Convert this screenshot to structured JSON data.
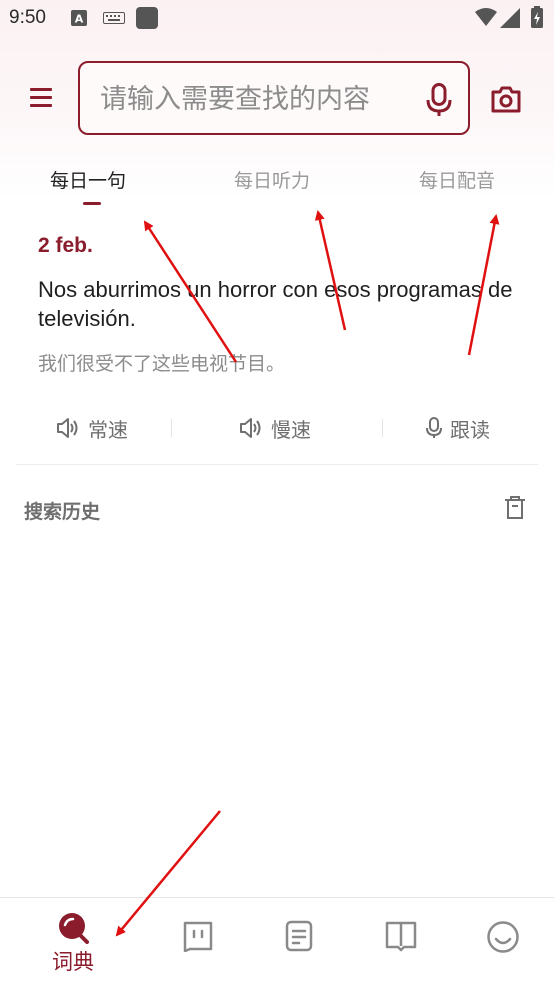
{
  "status_bar": {
    "time": "9:50",
    "icons": [
      "a-notification-icon",
      "keyboard-icon",
      "square-app-icon",
      "wifi-icon",
      "signal-icon",
      "battery-icon"
    ]
  },
  "search": {
    "placeholder": "请输入需要查找的内容",
    "value": ""
  },
  "tabs": [
    {
      "label": "每日一句",
      "active": true
    },
    {
      "label": "每日听力",
      "active": false
    },
    {
      "label": "每日配音",
      "active": false
    }
  ],
  "daily_sentence": {
    "date": "2 feb.",
    "sentence": "Nos aburrimos un horror con esos programas de televisión.",
    "translation": "我们很受不了这些电视节目。"
  },
  "audio_controls": {
    "normal_speed": "常速",
    "slow_speed": "慢速",
    "follow_read": "跟读"
  },
  "history": {
    "title": "搜索历史"
  },
  "bottom_nav": {
    "items": [
      {
        "label": "词典",
        "icon": "dictionary-search-icon",
        "active": true
      },
      {
        "label": "",
        "icon": "chat-card-icon",
        "active": false
      },
      {
        "label": "",
        "icon": "notes-icon",
        "active": false
      },
      {
        "label": "",
        "icon": "book-icon",
        "active": false
      },
      {
        "label": "",
        "icon": "smiley-profile-icon",
        "active": false
      }
    ]
  },
  "colors": {
    "accent": "#8a1c2c",
    "annotation_arrow": "#e01010",
    "muted_text": "#8c8c8c"
  }
}
